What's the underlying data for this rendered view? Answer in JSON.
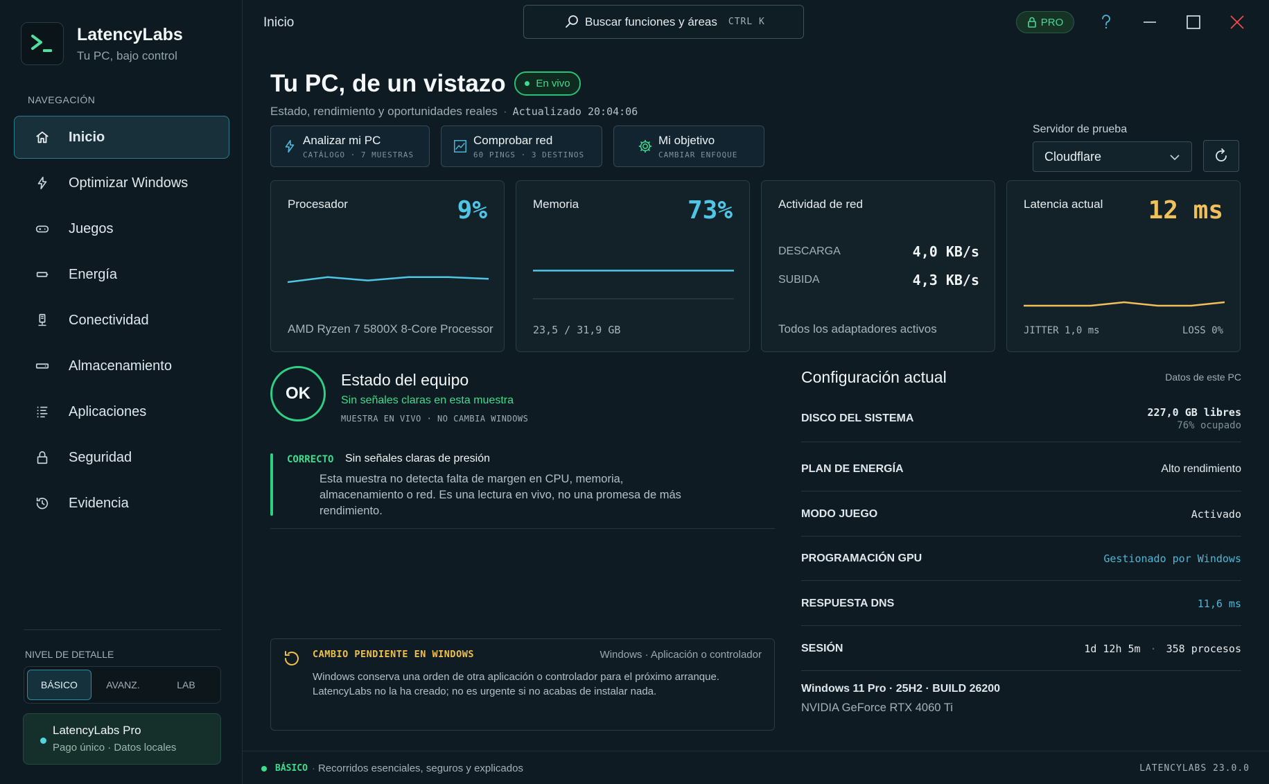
{
  "brand": {
    "name": "LatencyLabs",
    "subtitle": "Tu PC, bajo control"
  },
  "sidebar": {
    "heading": "NAVEGACIÓN",
    "items": [
      {
        "label": "Inicio",
        "icon": "home-icon",
        "active": true
      },
      {
        "label": "Optimizar Windows",
        "icon": "bolt-icon"
      },
      {
        "label": "Juegos",
        "icon": "gamepad-icon"
      },
      {
        "label": "Energía",
        "icon": "battery-icon"
      },
      {
        "label": "Conectividad",
        "icon": "network-icon"
      },
      {
        "label": "Almacenamiento",
        "icon": "drive-icon"
      },
      {
        "label": "Aplicaciones",
        "icon": "list-icon"
      },
      {
        "label": "Seguridad",
        "icon": "lock-icon"
      },
      {
        "label": "Evidencia",
        "icon": "history-icon"
      }
    ],
    "detail_heading": "NIVEL DE DETALLE",
    "detail_levels": [
      "BÁSICO",
      "AVANZ.",
      "LAB"
    ],
    "detail_selected": "BÁSICO",
    "pro": {
      "title": "LatencyLabs Pro",
      "subtitle": "Pago único · Datos locales"
    }
  },
  "topbar": {
    "title": "Inicio",
    "search_placeholder": "Buscar funciones y áreas",
    "search_shortcut": "CTRL K",
    "pro_badge": "PRO"
  },
  "header": {
    "title": "Tu PC, de un vistazo",
    "live_badge": "En vivo",
    "subtitle": "Estado, rendimiento y oportunidades reales",
    "updated": "Actualizado 20:04:06"
  },
  "actions": [
    {
      "title": "Analizar mi PC",
      "sub": "CATÁLOGO · 7 MUESTRAS",
      "icon": "bolt-icon"
    },
    {
      "title": "Comprobar red",
      "sub": "60 PINGS · 3 DESTINOS",
      "icon": "chart-icon"
    },
    {
      "title": "Mi objetivo",
      "sub": "CAMBIAR ENFOQUE",
      "icon": "gear-icon"
    }
  ],
  "server": {
    "label": "Servidor de prueba",
    "selected": "Cloudflare"
  },
  "cards": {
    "cpu": {
      "title": "Procesador",
      "value": "9%",
      "foot": "AMD Ryzen 7 5800X 8-Core Processor",
      "series": [
        0.1,
        0.13,
        0.11,
        0.13,
        0.13,
        0.12
      ]
    },
    "memory": {
      "title": "Memoria",
      "value": "73%",
      "foot": "23,5 / 31,9 GB",
      "series": [
        0.73,
        0.73,
        0.73,
        0.73,
        0.73,
        0.73
      ]
    },
    "network": {
      "title": "Actividad de red",
      "down_label": "DESCARGA",
      "down_value": "4,0 KB/s",
      "up_label": "SUBIDA",
      "up_value": "4,3 KB/s",
      "foot": "Todos los adaptadores activos"
    },
    "latency": {
      "title": "Latencia actual",
      "value": "12 ms",
      "jitter": "JITTER 1,0 ms",
      "loss": "LOSS 0%",
      "series": [
        0.12,
        0.12,
        0.12,
        0.13,
        0.12,
        0.12,
        0.13
      ]
    }
  },
  "colors": {
    "accent": "#4fc6e6",
    "ok": "#2fcf85",
    "warn": "#f0bf4c",
    "latency": "#f0c15a"
  },
  "status": {
    "badge": "OK",
    "title": "Estado del equipo",
    "subtitle": "Sin señales claras en esta muestra",
    "meta": "MUESTRA EN VIVO · NO CAMBIA WINDOWS",
    "finding_tag": "CORRECTO",
    "finding_title": "Sin señales claras de presión",
    "finding_body": "Esta muestra no detecta falta de margen en CPU, memoria, almacenamiento o red. Es una lectura en vivo, no una promesa de más rendimiento."
  },
  "pending": {
    "tag": "CAMBIO PENDIENTE EN WINDOWS",
    "source": "Windows · Aplicación o controlador",
    "body": "Windows conserva una orden de otra aplicación o controlador para el próximo arranque. LatencyLabs no la ha creado; no es urgente si no acabas de instalar nada."
  },
  "config": {
    "title": "Configuración actual",
    "note": "Datos de este PC",
    "rows": [
      {
        "key": "DISCO DEL SISTEMA",
        "value": "227,0 GB libres",
        "sub": "76% ocupado"
      },
      {
        "key": "PLAN DE ENERGÍA",
        "value": "Alto rendimiento"
      },
      {
        "key": "MODO JUEGO",
        "value": "Activado"
      },
      {
        "key": "PROGRAMACIÓN GPU",
        "value": "Gestionado por Windows"
      },
      {
        "key": "RESPUESTA DNS",
        "value": "11,6 ms"
      },
      {
        "key": "SESIÓN",
        "value": "1d 12h 5m",
        "value2": "358 procesos"
      }
    ],
    "os": "Windows 11 Pro · 25H2 · BUILD 26200",
    "gpu": "NVIDIA GeForce RTX 4060 Ti"
  },
  "footer": {
    "mode": "BÁSICO",
    "desc": "Recorridos esenciales, seguros y explicados",
    "version": "LATENCYLABS 23.0.0"
  }
}
